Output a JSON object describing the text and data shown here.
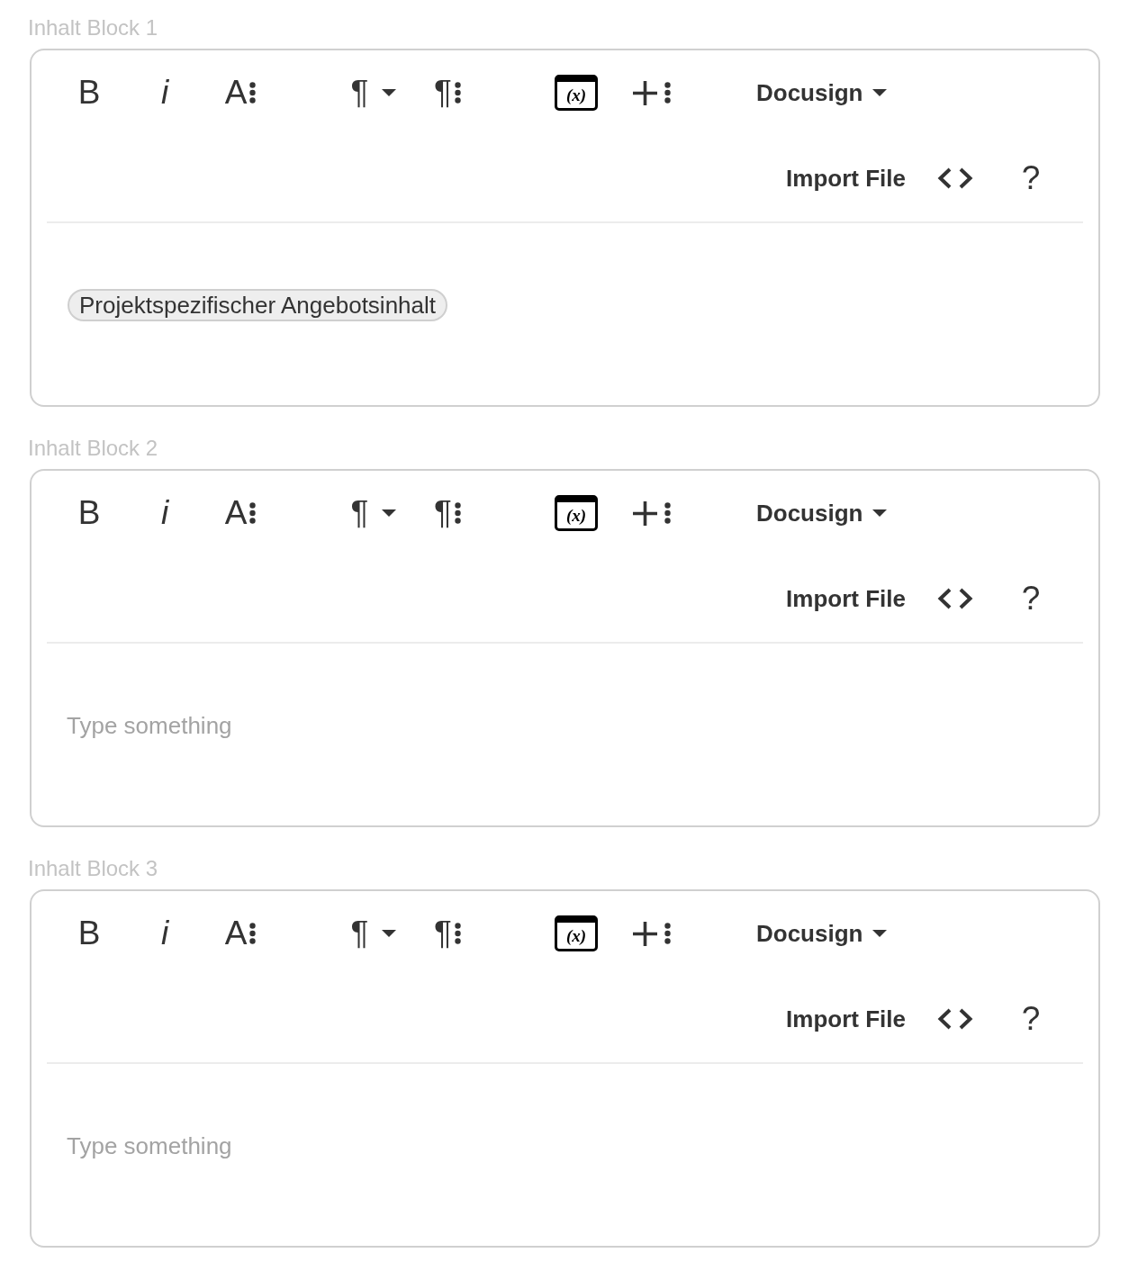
{
  "blocks": [
    {
      "label": "Inhalt Block 1",
      "toolbar": [
        {
          "groups": [
            [
              {
                "kind": "glyph",
                "label": "B",
                "italic": false
              },
              {
                "kind": "glyph",
                "label": "i",
                "italic": true
              },
              {
                "kind": "glyph-more",
                "label": "A"
              }
            ],
            [
              {
                "kind": "glyph-dropdown",
                "label": "¶"
              },
              {
                "kind": "glyph-more",
                "label": "¶"
              }
            ],
            [
              {
                "kind": "framed",
                "label": "(x)"
              },
              {
                "kind": "plus-more"
              }
            ],
            [
              {
                "kind": "text-dropdown",
                "label": "Docusign"
              }
            ]
          ]
        },
        {
          "groups": [
            [
              {
                "kind": "text",
                "label": "Import File"
              },
              {
                "kind": "code"
              },
              {
                "kind": "glyph",
                "label": "?",
                "italic": false
              }
            ]
          ]
        }
      ],
      "editor": {
        "tokens": [
          "Projektspezifischer Angebotsinhalt"
        ]
      }
    },
    {
      "label": "Inhalt Block 2",
      "toolbar": [
        {
          "groups": [
            [
              {
                "kind": "glyph",
                "label": "B",
                "italic": false
              },
              {
                "kind": "glyph",
                "label": "i",
                "italic": true
              },
              {
                "kind": "glyph-more",
                "label": "A"
              }
            ],
            [
              {
                "kind": "glyph-dropdown",
                "label": "¶"
              },
              {
                "kind": "glyph-more",
                "label": "¶"
              }
            ],
            [
              {
                "kind": "framed",
                "label": "(x)"
              },
              {
                "kind": "plus-more"
              }
            ],
            [
              {
                "kind": "text-dropdown",
                "label": "Docusign"
              }
            ]
          ]
        },
        {
          "groups": [
            [
              {
                "kind": "text",
                "label": "Import File"
              },
              {
                "kind": "code"
              },
              {
                "kind": "glyph",
                "label": "?",
                "italic": false
              }
            ]
          ]
        }
      ],
      "editor": {
        "placeholder": "Type something"
      }
    },
    {
      "label": "Inhalt Block 3",
      "toolbar": [
        {
          "groups": [
            [
              {
                "kind": "glyph",
                "label": "B",
                "italic": false
              },
              {
                "kind": "glyph",
                "label": "i",
                "italic": true
              },
              {
                "kind": "glyph-more",
                "label": "A"
              }
            ],
            [
              {
                "kind": "glyph-dropdown",
                "label": "¶"
              },
              {
                "kind": "glyph-more",
                "label": "¶"
              }
            ],
            [
              {
                "kind": "framed",
                "label": "(x)"
              },
              {
                "kind": "plus-more"
              }
            ],
            [
              {
                "kind": "text-dropdown",
                "label": "Docusign"
              }
            ]
          ]
        },
        {
          "groups": [
            [
              {
                "kind": "text",
                "label": "Import File"
              },
              {
                "kind": "code"
              },
              {
                "kind": "glyph",
                "label": "?",
                "italic": false
              }
            ]
          ]
        }
      ],
      "editor": {
        "placeholder": "Type something"
      }
    }
  ]
}
